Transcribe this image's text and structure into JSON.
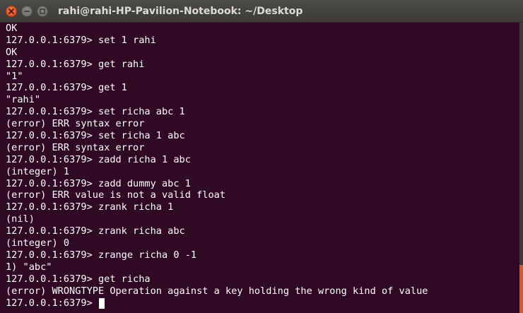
{
  "window": {
    "title": "rahi@rahi-HP-Pavilion-Notebook: ~/Desktop"
  },
  "colors": {
    "terminal_bg": "#300a24",
    "titlebar_bg": "#3c3b37",
    "close_button": "#dd4814",
    "text": "#ffffff",
    "scroll_thumb": "#e0561b"
  },
  "terminal": {
    "lines": [
      "OK",
      "127.0.0.1:6379> set 1 rahi",
      "OK",
      "127.0.0.1:6379> get rahi",
      "\"1\"",
      "127.0.0.1:6379> get 1",
      "\"rahi\"",
      "127.0.0.1:6379> set richa abc 1",
      "(error) ERR syntax error",
      "127.0.0.1:6379> set richa 1 abc",
      "(error) ERR syntax error",
      "127.0.0.1:6379> zadd richa 1 abc",
      "(integer) 1",
      "127.0.0.1:6379> zadd dummy abc 1",
      "(error) ERR value is not a valid float",
      "127.0.0.1:6379> zrank richa 1",
      "(nil)",
      "127.0.0.1:6379> zrank richa abc",
      "(integer) 0",
      "127.0.0.1:6379> zrange richa 0 -1",
      "1) \"abc\"",
      "127.0.0.1:6379> get richa",
      "(error) WRONGTYPE Operation against a key holding the wrong kind of value"
    ],
    "prompt": "127.0.0.1:6379> "
  }
}
